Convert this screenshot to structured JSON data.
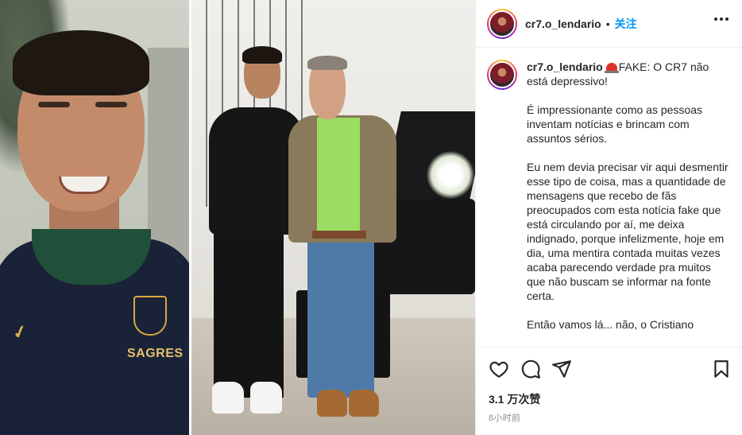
{
  "post": {
    "username": "cr7.o_lendario",
    "separator": "•",
    "follow_label": "关注",
    "caption": {
      "username": "cr7.o_lendario",
      "paragraphs": [
        "FAKE: O CR7 não está depressivo!",
        "É impressionante como as pessoas inventam notícias e brincam com assuntos sérios.",
        "Eu nem devia precisar vir aqui desmentir esse tipo de coisa, mas a quantidade de mensagens que recebo de fãs preocupados com esta notícia fake que está circulando por aí, me deixa indignado, porque infelizmente, hoje em dia, uma mentira contada muitas vezes acaba parecendo verdade pra muitos que não buscam se informar na fonte certa.",
        "Então vamos lá... não, o Cristiano"
      ]
    },
    "likes": "3.1 万次赞",
    "time": "8小时前"
  },
  "media": {
    "jersey_sponsor": "SAGRES"
  },
  "icons": {
    "more": "more-options-icon",
    "like": "heart-icon",
    "comment": "comment-icon",
    "share": "share-icon",
    "save": "bookmark-icon",
    "caption_emoji": "siren-emoji-icon"
  },
  "colors": {
    "follow": "#0095f6",
    "text": "#262626",
    "muted": "#8e8e8e",
    "border": "#efefef"
  }
}
